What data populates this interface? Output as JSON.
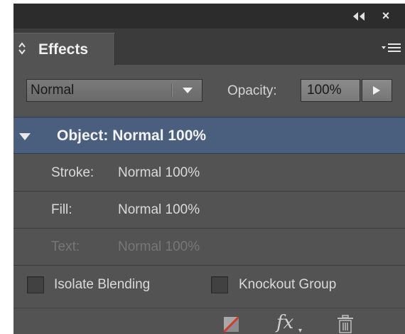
{
  "panel": {
    "tab_label": "Effects",
    "collapse_icon": "double-chevron-left-icon",
    "close_label": "×",
    "menu_icon": "panel-menu-icon"
  },
  "blend": {
    "mode": "Normal",
    "opacity_label": "Opacity:",
    "opacity_value": "100%"
  },
  "rows": {
    "object": {
      "label": "Object:",
      "value": "Normal 100%"
    },
    "stroke": {
      "label": "Stroke:",
      "value": "Normal 100%"
    },
    "fill": {
      "label": "Fill:",
      "value": "Normal 100%"
    },
    "text": {
      "label": "Text:",
      "value": "Normal 100%"
    }
  },
  "options": {
    "isolate_label": "Isolate Blending",
    "knockout_label": "Knockout Group"
  },
  "footer": {
    "fx_label": "fx",
    "fx_caret": "▾"
  },
  "colors": {
    "panel_bg": "#535353",
    "selected_row": "#4a5f7e",
    "title_bar": "#2c2c2c"
  }
}
